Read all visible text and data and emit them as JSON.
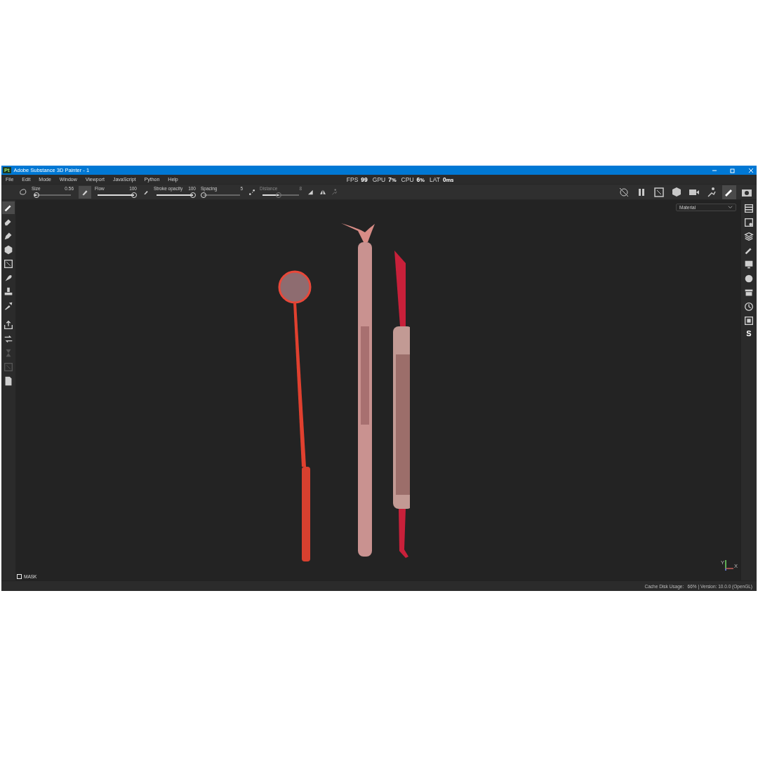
{
  "window": {
    "title": "Adobe Substance 3D Painter - 1",
    "app_badge": "Pt"
  },
  "menu": [
    "File",
    "Edit",
    "Mode",
    "Window",
    "Viewport",
    "JavaScript",
    "Python",
    "Help"
  ],
  "stats": [
    {
      "label": "FPS",
      "value": "99"
    },
    {
      "label": "GPU",
      "value": "7",
      "unit": "%"
    },
    {
      "label": "CPU",
      "value": "6",
      "unit": "%"
    },
    {
      "label": "LAT",
      "value": "0",
      "unit": "ms"
    }
  ],
  "toolbar": {
    "sliders": [
      {
        "label": "Size",
        "reading": "0.56",
        "level": 0.05,
        "disabled": false
      },
      {
        "label": "Flow",
        "reading": "100",
        "level": 1,
        "disabled": false
      },
      {
        "label": "Stroke opacity",
        "reading": "100",
        "level": 1,
        "disabled": false
      },
      {
        "label": "Spacing",
        "reading": "5",
        "level": 0.0,
        "disabled": false
      },
      {
        "label": "Distance",
        "reading": "8",
        "level": 0.45,
        "disabled": true
      }
    ]
  },
  "tools": [
    {
      "kind": "brush",
      "selected": true,
      "disabled": false
    },
    {
      "kind": "eraser",
      "selected": false,
      "disabled": false
    },
    {
      "kind": "pen",
      "selected": false,
      "disabled": false
    },
    {
      "kind": "hexagon",
      "selected": false,
      "disabled": false
    },
    {
      "kind": "frame",
      "selected": false,
      "disabled": false
    },
    {
      "kind": "drop",
      "selected": false,
      "disabled": false
    },
    {
      "kind": "stamp",
      "selected": false,
      "disabled": false
    },
    {
      "kind": "picker",
      "selected": false,
      "disabled": false
    },
    {
      "kind": "export",
      "selected": false,
      "disabled": false
    },
    {
      "kind": "swap",
      "selected": false,
      "disabled": false
    },
    {
      "kind": "hourglass",
      "selected": false,
      "disabled": true
    },
    {
      "kind": "frame",
      "selected": false,
      "disabled": true
    },
    {
      "kind": "page",
      "selected": false,
      "disabled": false
    }
  ],
  "viewport_tools": [
    {
      "selected": false
    },
    {
      "selected": false
    },
    {
      "selected": false
    },
    {
      "selected": false
    },
    {
      "selected": false
    },
    {
      "selected": false
    },
    {
      "selected": true
    },
    {
      "selected": false
    }
  ],
  "viewport": {
    "channel": "Material",
    "mask": {
      "label": "MASK",
      "checked": false
    },
    "axis": {
      "y": "Y",
      "x": "X"
    }
  },
  "side_logo": "S",
  "status_bar": "Cache Disk Usage:   66% | Version: 10.0.0 (OpenGL)"
}
